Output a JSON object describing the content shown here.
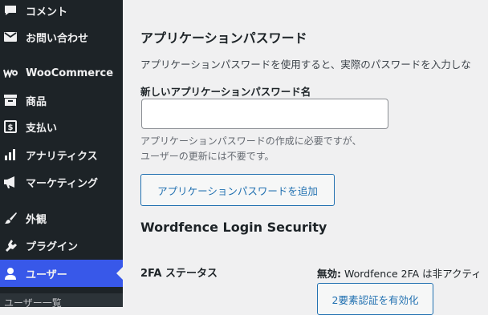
{
  "sidebar": {
    "items": [
      {
        "label": "コメント",
        "icon": "comment-icon"
      },
      {
        "label": "お問い合わせ",
        "icon": "mail-icon"
      },
      {
        "label": "WooCommerce",
        "icon": "woocommerce-icon"
      },
      {
        "label": "商品",
        "icon": "archive-icon"
      },
      {
        "label": "支払い",
        "icon": "payment-icon"
      },
      {
        "label": "アナリティクス",
        "icon": "chart-bar-icon"
      },
      {
        "label": "マーケティング",
        "icon": "megaphone-icon"
      },
      {
        "label": "外観",
        "icon": "paintbrush-icon"
      },
      {
        "label": "プラグイン",
        "icon": "plugin-icon"
      },
      {
        "label": "ユーザー",
        "icon": "user-icon",
        "active": true
      }
    ],
    "submenu": {
      "label": "ユーザー一覧"
    },
    "colors": {
      "background": "#1d2327",
      "active": "#3858e9",
      "text": "#f0f0f1"
    }
  },
  "app_passwords": {
    "title": "アプリケーションパスワード",
    "description": "アプリケーションパスワードを使用すると、実際のパスワードを入力しな",
    "name_label": "新しいアプリケーションパスワード名",
    "name_value": "",
    "help_line1": "アプリケーションパスワードの作成に必要ですが、",
    "help_line2": "ユーザーの更新には不要です。",
    "add_button": "アプリケーションパスワードを追加"
  },
  "wordfence": {
    "title": "Wordfence Login Security",
    "row_label": "2FA ステータス",
    "status_prefix": "無効:",
    "status_text": " Wordfence 2FA は非アクティ",
    "enable_button": "2要素認証を有効化"
  }
}
